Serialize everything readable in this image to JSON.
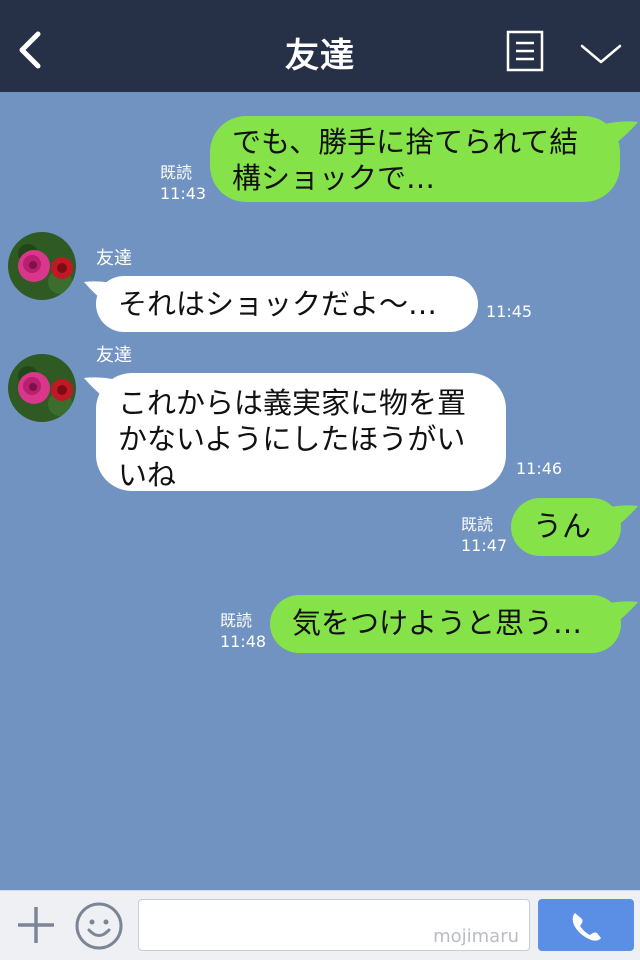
{
  "header": {
    "title": "友達",
    "icons": [
      "chevron-left-icon",
      "notes-icon",
      "chevron-down-icon"
    ]
  },
  "messages": [
    {
      "side": "out",
      "text": "でも、勝手に捨てられて結構ショックで…",
      "read": "既読",
      "time": "11:43"
    },
    {
      "side": "in",
      "sender": "友達",
      "text": "それはショックだよ〜…",
      "time": "11:45"
    },
    {
      "side": "in",
      "sender": "友達",
      "text": "これからは義実家に物を置かないようにしたほうがいいね",
      "time": "11:46"
    },
    {
      "side": "out",
      "text": "うん",
      "read": "既読",
      "time": "11:47"
    },
    {
      "side": "out",
      "text": "気をつけようと思う…",
      "read": "既読",
      "time": "11:48"
    }
  ],
  "input": {
    "value": "",
    "watermark": "mojimaru"
  },
  "colors": {
    "header_bg": "#263047",
    "chat_bg": "#7193c1",
    "outgoing_bubble": "#85e249",
    "incoming_bubble": "#ffffff",
    "call_button": "#5b8fe6"
  }
}
